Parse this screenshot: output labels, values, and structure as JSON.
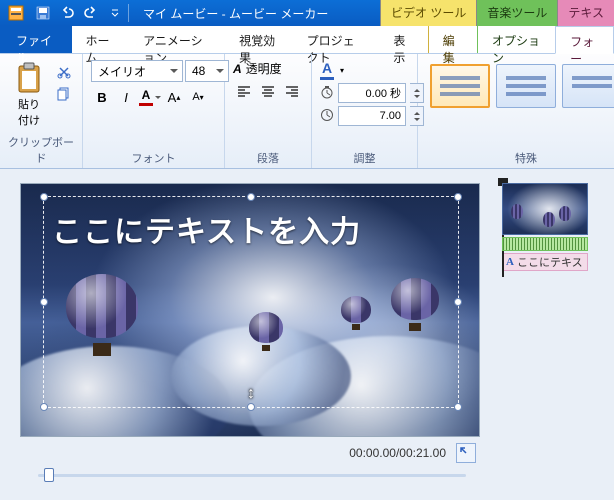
{
  "titlebar": {
    "title": "マイ ムービー - ムービー メーカー",
    "context_tabs": {
      "video": "ビデオ ツール",
      "audio": "音楽ツール",
      "text": "テキス"
    }
  },
  "tabs": {
    "file": "ファイル",
    "home": "ホーム",
    "anim": "アニメーション",
    "visual": "視覚効果",
    "project": "プロジェクト",
    "view": "表示",
    "edit": "編集",
    "options": "オプション",
    "format": "フォー"
  },
  "ribbon": {
    "clipboard": {
      "paste": "貼り\n付け",
      "label": "クリップボード"
    },
    "font": {
      "name": "メイリオ",
      "size": "48",
      "bold": "B",
      "italic": "I",
      "label": "フォント"
    },
    "paragraph": {
      "transparency_label": "透明度",
      "label": "段落"
    },
    "adjust": {
      "start_time": "0.00 秒",
      "duration": "7.00",
      "label": "調整"
    },
    "special": {
      "label": "特殊"
    }
  },
  "preview": {
    "placeholder_text": "ここにテキストを入力",
    "time": "00:00.00/00:21.00"
  },
  "timeline": {
    "text_clip_label": "ここにテキス"
  }
}
